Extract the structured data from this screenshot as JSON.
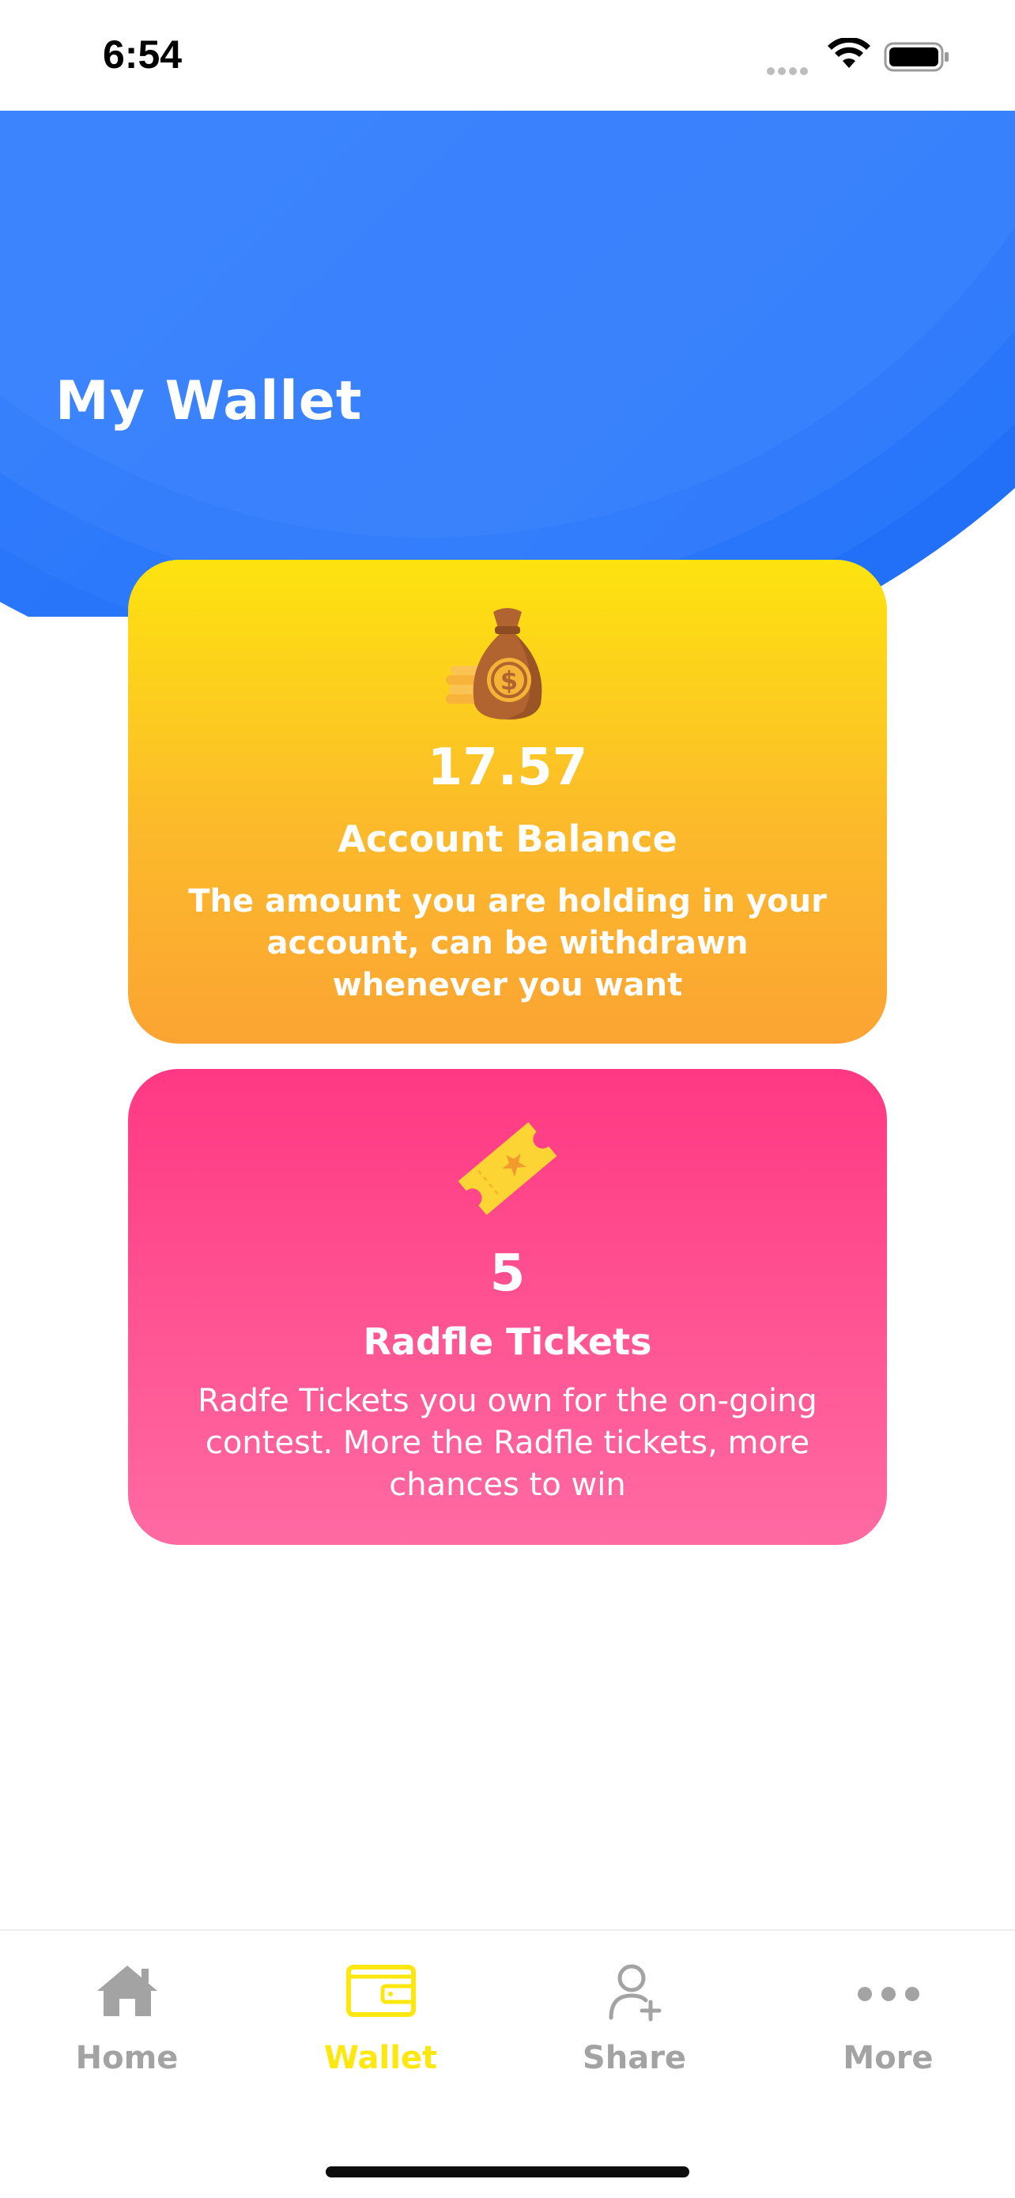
{
  "status_bar": {
    "time": "6:54"
  },
  "header": {
    "title": "My Wallet",
    "color": "#2f7bff"
  },
  "balance_card": {
    "value": "17.57",
    "title": "Account Balance",
    "description": "The amount you are holding in your account, can be withdrawn whenever you want",
    "icon": "money-bag-icon"
  },
  "tickets_card": {
    "value": "5",
    "title": "Radfle Tickets",
    "description": "Radfe Tickets you own for the on-going contest. More the Radfle tickets, more chances to win",
    "icon": "ticket-icon"
  },
  "tab_bar": {
    "items": [
      {
        "label": "Home",
        "icon": "home-icon",
        "active": false
      },
      {
        "label": "Wallet",
        "icon": "wallet-icon",
        "active": true
      },
      {
        "label": "Share",
        "icon": "add-user-icon",
        "active": false
      },
      {
        "label": "More",
        "icon": "more-icon",
        "active": false
      }
    ],
    "active_color": "#fce70f",
    "inactive_color": "#a3a3a3"
  }
}
